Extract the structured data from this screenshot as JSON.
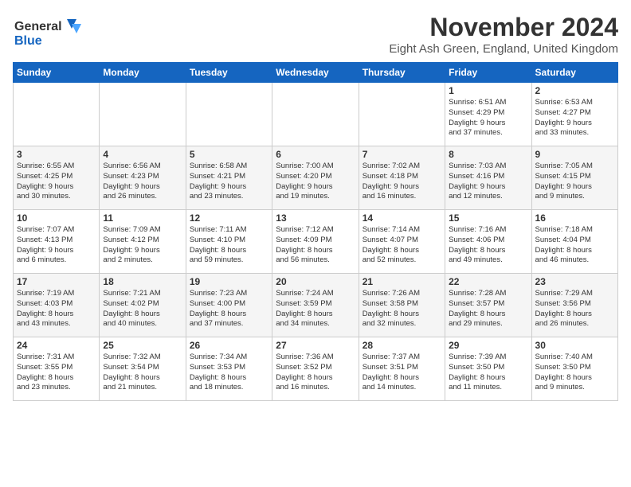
{
  "header": {
    "logo_line1": "General",
    "logo_line2": "Blue",
    "month": "November 2024",
    "location": "Eight Ash Green, England, United Kingdom"
  },
  "weekdays": [
    "Sunday",
    "Monday",
    "Tuesday",
    "Wednesday",
    "Thursday",
    "Friday",
    "Saturday"
  ],
  "weeks": [
    [
      {
        "day": "",
        "content": ""
      },
      {
        "day": "",
        "content": ""
      },
      {
        "day": "",
        "content": ""
      },
      {
        "day": "",
        "content": ""
      },
      {
        "day": "",
        "content": ""
      },
      {
        "day": "1",
        "content": "Sunrise: 6:51 AM\nSunset: 4:29 PM\nDaylight: 9 hours\nand 37 minutes."
      },
      {
        "day": "2",
        "content": "Sunrise: 6:53 AM\nSunset: 4:27 PM\nDaylight: 9 hours\nand 33 minutes."
      }
    ],
    [
      {
        "day": "3",
        "content": "Sunrise: 6:55 AM\nSunset: 4:25 PM\nDaylight: 9 hours\nand 30 minutes."
      },
      {
        "day": "4",
        "content": "Sunrise: 6:56 AM\nSunset: 4:23 PM\nDaylight: 9 hours\nand 26 minutes."
      },
      {
        "day": "5",
        "content": "Sunrise: 6:58 AM\nSunset: 4:21 PM\nDaylight: 9 hours\nand 23 minutes."
      },
      {
        "day": "6",
        "content": "Sunrise: 7:00 AM\nSunset: 4:20 PM\nDaylight: 9 hours\nand 19 minutes."
      },
      {
        "day": "7",
        "content": "Sunrise: 7:02 AM\nSunset: 4:18 PM\nDaylight: 9 hours\nand 16 minutes."
      },
      {
        "day": "8",
        "content": "Sunrise: 7:03 AM\nSunset: 4:16 PM\nDaylight: 9 hours\nand 12 minutes."
      },
      {
        "day": "9",
        "content": "Sunrise: 7:05 AM\nSunset: 4:15 PM\nDaylight: 9 hours\nand 9 minutes."
      }
    ],
    [
      {
        "day": "10",
        "content": "Sunrise: 7:07 AM\nSunset: 4:13 PM\nDaylight: 9 hours\nand 6 minutes."
      },
      {
        "day": "11",
        "content": "Sunrise: 7:09 AM\nSunset: 4:12 PM\nDaylight: 9 hours\nand 2 minutes."
      },
      {
        "day": "12",
        "content": "Sunrise: 7:11 AM\nSunset: 4:10 PM\nDaylight: 8 hours\nand 59 minutes."
      },
      {
        "day": "13",
        "content": "Sunrise: 7:12 AM\nSunset: 4:09 PM\nDaylight: 8 hours\nand 56 minutes."
      },
      {
        "day": "14",
        "content": "Sunrise: 7:14 AM\nSunset: 4:07 PM\nDaylight: 8 hours\nand 52 minutes."
      },
      {
        "day": "15",
        "content": "Sunrise: 7:16 AM\nSunset: 4:06 PM\nDaylight: 8 hours\nand 49 minutes."
      },
      {
        "day": "16",
        "content": "Sunrise: 7:18 AM\nSunset: 4:04 PM\nDaylight: 8 hours\nand 46 minutes."
      }
    ],
    [
      {
        "day": "17",
        "content": "Sunrise: 7:19 AM\nSunset: 4:03 PM\nDaylight: 8 hours\nand 43 minutes."
      },
      {
        "day": "18",
        "content": "Sunrise: 7:21 AM\nSunset: 4:02 PM\nDaylight: 8 hours\nand 40 minutes."
      },
      {
        "day": "19",
        "content": "Sunrise: 7:23 AM\nSunset: 4:00 PM\nDaylight: 8 hours\nand 37 minutes."
      },
      {
        "day": "20",
        "content": "Sunrise: 7:24 AM\nSunset: 3:59 PM\nDaylight: 8 hours\nand 34 minutes."
      },
      {
        "day": "21",
        "content": "Sunrise: 7:26 AM\nSunset: 3:58 PM\nDaylight: 8 hours\nand 32 minutes."
      },
      {
        "day": "22",
        "content": "Sunrise: 7:28 AM\nSunset: 3:57 PM\nDaylight: 8 hours\nand 29 minutes."
      },
      {
        "day": "23",
        "content": "Sunrise: 7:29 AM\nSunset: 3:56 PM\nDaylight: 8 hours\nand 26 minutes."
      }
    ],
    [
      {
        "day": "24",
        "content": "Sunrise: 7:31 AM\nSunset: 3:55 PM\nDaylight: 8 hours\nand 23 minutes."
      },
      {
        "day": "25",
        "content": "Sunrise: 7:32 AM\nSunset: 3:54 PM\nDaylight: 8 hours\nand 21 minutes."
      },
      {
        "day": "26",
        "content": "Sunrise: 7:34 AM\nSunset: 3:53 PM\nDaylight: 8 hours\nand 18 minutes."
      },
      {
        "day": "27",
        "content": "Sunrise: 7:36 AM\nSunset: 3:52 PM\nDaylight: 8 hours\nand 16 minutes."
      },
      {
        "day": "28",
        "content": "Sunrise: 7:37 AM\nSunset: 3:51 PM\nDaylight: 8 hours\nand 14 minutes."
      },
      {
        "day": "29",
        "content": "Sunrise: 7:39 AM\nSunset: 3:50 PM\nDaylight: 8 hours\nand 11 minutes."
      },
      {
        "day": "30",
        "content": "Sunrise: 7:40 AM\nSunset: 3:50 PM\nDaylight: 8 hours\nand 9 minutes."
      }
    ]
  ]
}
